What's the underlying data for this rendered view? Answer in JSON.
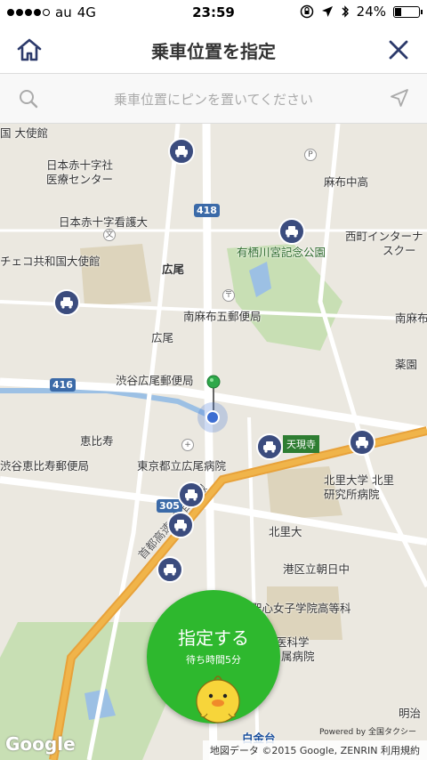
{
  "status": {
    "carrier": "au",
    "network": "4G",
    "time": "23:59",
    "battery": "24%"
  },
  "nav": {
    "title": "乗車位置を指定"
  },
  "search": {
    "placeholder": "乗車位置にピンを置いてください"
  },
  "map": {
    "labels": [
      {
        "id": "embassy-top",
        "text": "国 大使館"
      },
      {
        "id": "red-cross-med",
        "text": "日本赤十字社"
      },
      {
        "id": "med-center",
        "text": "医療センター"
      },
      {
        "id": "red-cross-univ",
        "text": "日本赤十字看護大"
      },
      {
        "id": "czech-embassy",
        "text": "チェコ共和国大使館"
      },
      {
        "id": "hiroo-station",
        "text": "広尾"
      },
      {
        "id": "minami-azabu-post",
        "text": "南麻布五郵便局"
      },
      {
        "id": "hiroo-area",
        "text": "広尾"
      },
      {
        "id": "shibuya-hiroo-post",
        "text": "渋谷広尾郵便局"
      },
      {
        "id": "ebisu",
        "text": "恵比寿"
      },
      {
        "id": "shibuya-ebisu-post",
        "text": "渋谷恵比寿郵便局"
      },
      {
        "id": "hiroo-hospital",
        "text": "東京都立広尾病院"
      },
      {
        "id": "arisugawa",
        "text": "有栖川宮記念公園"
      },
      {
        "id": "azabu-high",
        "text": "麻布中高"
      },
      {
        "id": "nishimachi",
        "text": "西町インターナ"
      },
      {
        "id": "school",
        "text": "スクー"
      },
      {
        "id": "minami-azabu",
        "text": "南麻布"
      },
      {
        "id": "yakuen",
        "text": "薬園"
      },
      {
        "id": "kitasato-univ",
        "text": "北里大学 北里"
      },
      {
        "id": "kitasato-inst",
        "text": "研究所病院"
      },
      {
        "id": "kitasato",
        "text": "北里大"
      },
      {
        "id": "asahi-junior",
        "text": "港区立朝日中"
      },
      {
        "id": "seishin",
        "text": "聖心女子学院高等科"
      },
      {
        "id": "med-sci",
        "text": "医科学"
      },
      {
        "id": "hospital-suffix",
        "text": "属病院"
      },
      {
        "id": "shuto",
        "text": "首都高速2号目黒線"
      },
      {
        "id": "shirokane",
        "text": "白金台"
      },
      {
        "id": "meiji",
        "text": "明治"
      }
    ],
    "route_shields": {
      "r418": "418",
      "r416": "416",
      "r305": "305"
    },
    "station_label": "天現寺"
  },
  "confirm": {
    "label": "指定する",
    "sub": "待ち時間5分"
  },
  "attribution": {
    "text": "地図データ ©2015 Google, ZENRIN 利用規約",
    "powered": "Powered by 全国タクシー"
  },
  "google_logo": "Google"
}
